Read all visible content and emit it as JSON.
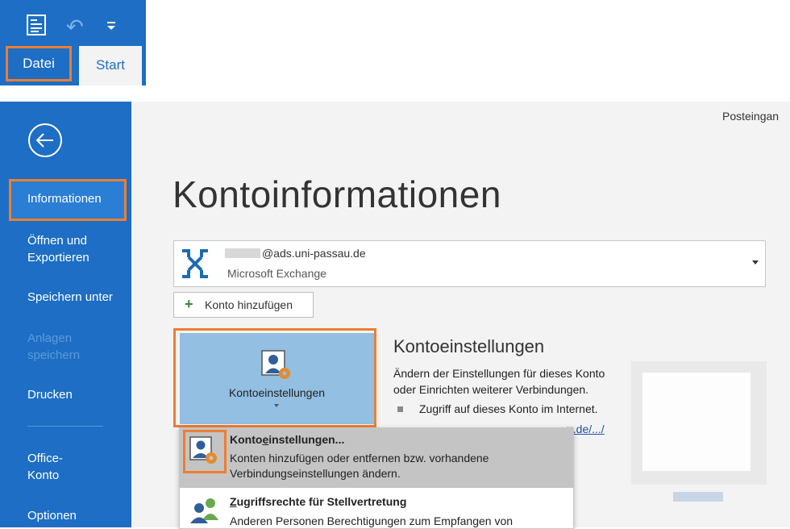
{
  "ribbon": {
    "tab_file": "Datei",
    "tab_start": "Start",
    "icons": [
      "view-icon",
      "undo-icon",
      "customize-qat-icon"
    ]
  },
  "nav": {
    "items": [
      {
        "label": "Informationen",
        "selected": true
      },
      {
        "label": "Öffnen und Exportieren"
      },
      {
        "label": "Speichern unter"
      },
      {
        "label": "Anlagen speichern",
        "disabled": true
      },
      {
        "label": "Drucken"
      },
      {
        "label": "Office-Konto"
      },
      {
        "label": "Optionen"
      }
    ]
  },
  "main": {
    "folder_title": "Posteingan",
    "page_title": "Kontoinformationen",
    "account": {
      "email_suffix": "@ads.uni-passau.de",
      "type": "Microsoft Exchange"
    },
    "add_account": "Konto hinzufügen",
    "account_settings_button": "Kontoeinstellungen",
    "section": {
      "title": "Kontoeinstellungen",
      "desc_line1": "Ändern der Einstellungen für dieses Konto",
      "desc_line2": "oder Einrichten weiterer Verbindungen.",
      "bullet": "Zugriff auf dieses Konto im Internet.",
      "link_fragment": "u.de/.../"
    }
  },
  "menu": {
    "item1": {
      "title_pre": "Konto",
      "title_u": "e",
      "title_post": "instellungen...",
      "desc": "Konten hinzufügen oder entfernen bzw. vorhandene Verbindungseinstellungen ändern."
    },
    "item2": {
      "title_u": "Z",
      "title_post": "ugriffsrechte für Stellvertretung",
      "desc": "Anderen Personen Berechtigungen zum Empfangen von"
    }
  },
  "colors": {
    "nav_blue": "#1d6ec4",
    "highlight_orange": "#ee7d31",
    "button_blue": "#92bfe2"
  }
}
